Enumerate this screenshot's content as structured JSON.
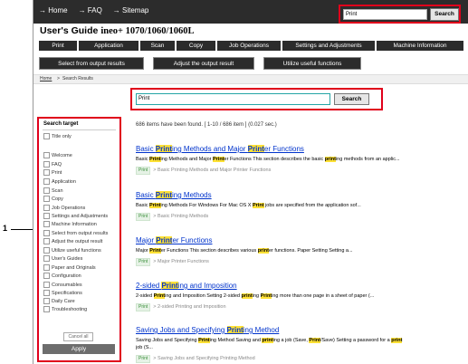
{
  "callout": {
    "number": "1"
  },
  "header": {
    "nav": [
      "→ Home",
      "→ FAQ",
      "→ Sitemap"
    ],
    "search_value": "Print",
    "search_button": "Search"
  },
  "guide": {
    "title": "User's Guide",
    "model": "ineo+ 1070/1060/1060L"
  },
  "main_nav": [
    "Print",
    "Application",
    "Scan",
    "Copy",
    "Job Operations",
    "Settings and Adjustments",
    "Machine Information"
  ],
  "sub_nav": [
    "Select from output results",
    "Adjust the output result",
    "Utilize useful functions"
  ],
  "breadcrumb": {
    "home": "Home",
    "separator": ">",
    "current": "Search Results"
  },
  "main_search": {
    "value": "Print",
    "button": "Search"
  },
  "sidebar": {
    "title": "Search target",
    "items": [
      "Title only",
      "Welcome",
      "FAQ",
      "Print",
      "Application",
      "Scan",
      "Copy",
      "Job Operations",
      "Settings and Adjustments",
      "Machine Information",
      "Select from output results",
      "Adjust the output result",
      "Utilize useful functions",
      "User's Guides",
      "Paper and Originals",
      "Configuration",
      "Consumables",
      "Specifications",
      "Daily Care",
      "Troubleshooting"
    ],
    "cancel": "Cancel all",
    "apply": "Apply"
  },
  "results": {
    "count_text": "686 items have been found. [ 1-10 / 686 item ] (0.027 sec.)",
    "items": [
      {
        "title": [
          "Basic ",
          "Print",
          "ing Methods and Major ",
          "Print",
          "er Functions"
        ],
        "desc": [
          "Basic ",
          "Print",
          "ing Methods and Major ",
          "Print",
          "er Functions This section describes the basic ",
          "print",
          "ing methods from an applic..."
        ],
        "tag": "Print",
        "path": "Basic Printing Methods and Major Printer Functions"
      },
      {
        "title": [
          "Basic ",
          "Print",
          "ing Methods"
        ],
        "desc": [
          "Basic ",
          "Print",
          "ing Methods For Windows For Mac OS X ",
          "Print",
          " jobs are specified from the application sof..."
        ],
        "tag": "Print",
        "path": "Basic Printing Methods"
      },
      {
        "title": [
          "Major ",
          "Print",
          "er Functions"
        ],
        "desc": [
          "Major ",
          "Print",
          "er Functions This section describes various ",
          "print",
          "er functions. Paper Setting Setting a..."
        ],
        "tag": "Print",
        "path": "Major Printer Functions"
      },
      {
        "title": [
          "2-sided ",
          "Print",
          "ing and Imposition"
        ],
        "desc": [
          "2-sided ",
          "Print",
          "ing and Imposition Setting 2-sided ",
          "print",
          "ing ",
          "Print",
          "ing more than one page in a sheet of paper (..."
        ],
        "tag": "Print",
        "path": "2-sided Printing and Imposition"
      },
      {
        "title": [
          "Saving Jobs and Specifying ",
          "Print",
          "ing Method"
        ],
        "desc": [
          "Saving Jobs and Specifying ",
          "Print",
          "ing Method Saving and ",
          "print",
          "ing a job (Save, ",
          "Print",
          "/Save) Setting a password for a ",
          "print"
        ],
        "desc2": "job (S...",
        "tag": "Print",
        "path": "Saving Jobs and Specifying Printing Method"
      }
    ]
  }
}
